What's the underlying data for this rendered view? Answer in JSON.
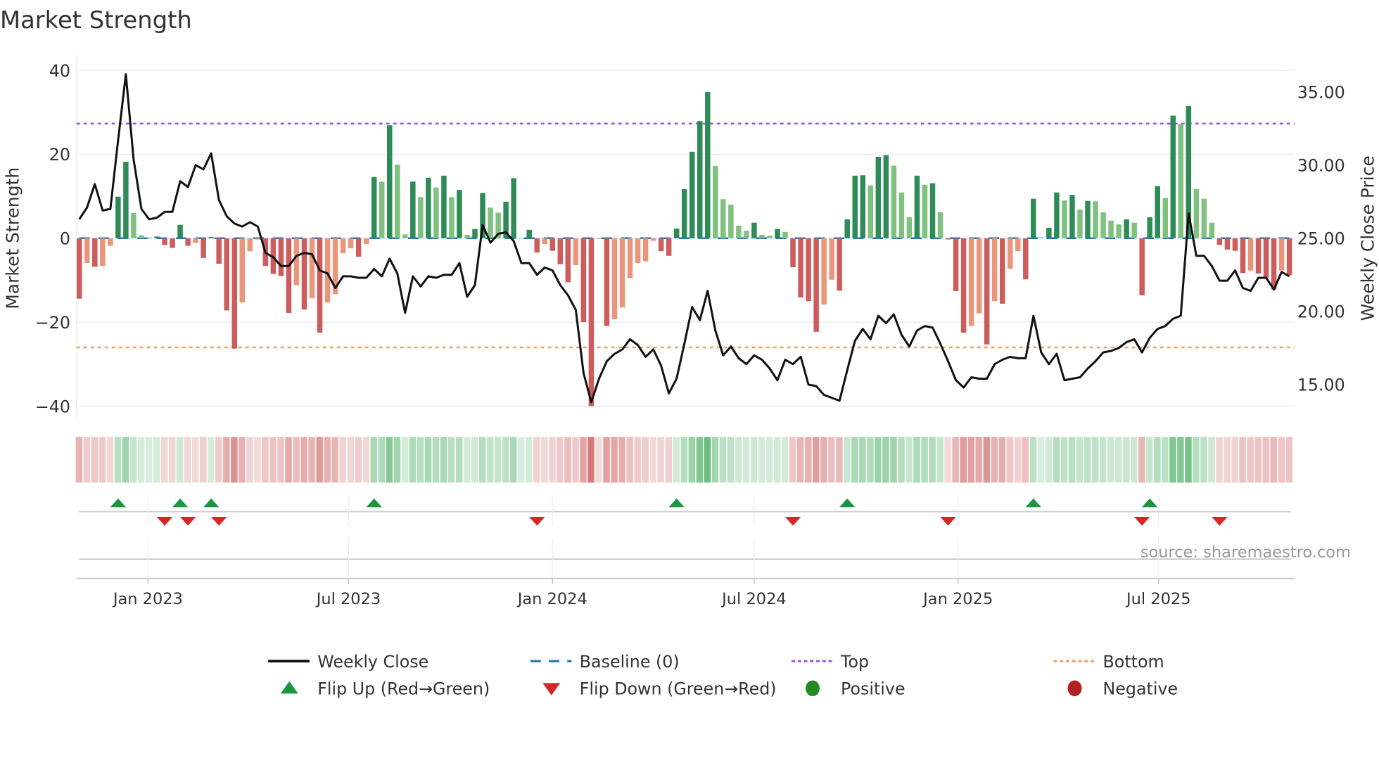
{
  "chart_data": {
    "type": "bar",
    "title": "Market Strength",
    "ylabel": "Market Strength",
    "y2label": "Weekly Close Price",
    "ylim": [
      -44,
      44
    ],
    "y2lim": [
      12.3,
      37.7
    ],
    "yticks": [
      40,
      20,
      0,
      -20,
      -40
    ],
    "yticklabels": [
      "40",
      "20",
      "0",
      "−20",
      "−40"
    ],
    "y2ticks": [
      35,
      30,
      25,
      20,
      15
    ],
    "y2ticklabels": [
      "35.00",
      "30.00",
      "25.00",
      "20.00",
      "15.00"
    ],
    "xticks": [
      "2023-01-01",
      "2023-07-01",
      "2024-01-01",
      "2024-07-01",
      "2025-01-01",
      "2025-07-01"
    ],
    "xticklabels": [
      "Jan 2023",
      "Jul 2023",
      "Jan 2024",
      "Jul 2024",
      "Jan 2025",
      "Jul 2025"
    ],
    "frequency": "weekly",
    "start_date": "2022-10-31",
    "strength": [
      -14.4,
      -5.9,
      -6.8,
      -6.6,
      -1.8,
      9.9,
      18.2,
      6.0,
      0.7,
      0.2,
      0.4,
      -1.6,
      -2.3,
      3.2,
      -1.8,
      -1.1,
      -4.7,
      0.3,
      -6.1,
      -17.2,
      -26.3,
      -15.3,
      -3.1,
      -0.3,
      -6.6,
      -8.5,
      -9.0,
      -17.8,
      -11.2,
      -17.0,
      -14.3,
      -22.5,
      -15.3,
      -13.3,
      -3.6,
      -2.4,
      -4.4,
      -1.4,
      14.6,
      13.5,
      26.9,
      17.5,
      0.9,
      13.5,
      9.8,
      14.4,
      12.1,
      14.9,
      9.8,
      11.5,
      0.8,
      2.2,
      10.8,
      7.3,
      6.1,
      8.7,
      14.3,
      0.1,
      2.0,
      -3.4,
      -1.4,
      -3.0,
      -6.2,
      -10.5,
      -6.4,
      -20.0,
      -40.0,
      -0.2,
      -20.9,
      -19.3,
      -16.5,
      -9.5,
      -5.9,
      -5.5,
      -0.6,
      -3.1,
      -4.2,
      2.3,
      11.7,
      20.6,
      27.9,
      34.8,
      17.2,
      9.3,
      8.0,
      3.0,
      1.8,
      3.7,
      0.8,
      0.6,
      2.2,
      1.5,
      -6.9,
      -14.1,
      -15.0,
      -22.3,
      -15.8,
      -9.9,
      -12.5,
      4.5,
      14.9,
      15.0,
      12.6,
      19.4,
      19.8,
      17.3,
      10.9,
      5.0,
      14.9,
      12.7,
      13.1,
      6.2,
      -0.3,
      -12.6,
      -22.5,
      -20.9,
      -17.9,
      -25.3,
      -15.0,
      -15.6,
      -7.3,
      -3.1,
      -9.8,
      9.4,
      0.2,
      2.5,
      10.9,
      9.0,
      10.3,
      6.8,
      8.9,
      8.8,
      6.2,
      4.2,
      3.3,
      4.5,
      3.7,
      -13.6,
      5.0,
      12.4,
      9.6,
      29.2,
      27.2,
      31.5,
      11.7,
      9.4,
      3.7,
      -1.6,
      -2.7,
      -3.0,
      -8.3,
      -7.7,
      -8.4,
      -9.4,
      -12.2,
      -7.7,
      -8.8
    ],
    "close": [
      26.3,
      27.1,
      28.7,
      26.9,
      27.0,
      31.7,
      36.2,
      30.4,
      27.0,
      26.3,
      26.4,
      26.8,
      26.8,
      28.9,
      28.5,
      30.0,
      29.7,
      30.8,
      27.6,
      26.5,
      26.0,
      25.8,
      26.1,
      25.8,
      24.0,
      23.7,
      23.1,
      23.1,
      23.8,
      24.0,
      23.9,
      22.8,
      22.6,
      21.6,
      22.4,
      22.4,
      22.3,
      22.3,
      22.9,
      22.4,
      23.6,
      22.6,
      19.9,
      22.4,
      21.7,
      22.4,
      22.3,
      22.5,
      22.5,
      23.3,
      21.0,
      21.8,
      25.9,
      24.7,
      25.3,
      25.4,
      24.8,
      23.3,
      23.3,
      22.5,
      23.0,
      22.8,
      21.8,
      21.1,
      20.1,
      15.8,
      13.8,
      15.4,
      16.6,
      17.1,
      17.4,
      18.1,
      17.7,
      16.9,
      17.4,
      16.3,
      14.4,
      15.4,
      17.8,
      20.3,
      19.4,
      21.4,
      18.7,
      17.0,
      17.6,
      16.8,
      16.4,
      17.0,
      16.7,
      16.1,
      15.3,
      16.7,
      16.4,
      16.9,
      15.0,
      14.9,
      14.3,
      14.1,
      13.9,
      16.0,
      18.0,
      18.8,
      18.1,
      19.7,
      19.2,
      19.8,
      18.4,
      17.6,
      18.7,
      19.0,
      18.9,
      17.8,
      16.6,
      15.3,
      14.8,
      15.5,
      15.4,
      15.4,
      16.4,
      16.7,
      16.9,
      16.8,
      16.8,
      19.7,
      17.2,
      16.4,
      17.1,
      15.3,
      15.4,
      15.5,
      16.1,
      16.6,
      17.2,
      17.3,
      17.5,
      17.9,
      18.1,
      17.2,
      18.2,
      18.8,
      19.0,
      19.5,
      19.7,
      26.7,
      23.8,
      23.8,
      23.1,
      22.1,
      22.1,
      22.8,
      21.6,
      21.4,
      22.3,
      22.3,
      21.5,
      22.7,
      22.4
    ],
    "top": 27.3,
    "bottom": -26.0,
    "baseline": 0,
    "grid": true,
    "legend_placement": "bottom",
    "legend": [
      "Weekly Close",
      "Baseline (0)",
      "Top",
      "Bottom",
      "Flip Up (Red→Green)",
      "Flip Down (Green→Red)",
      "Positive",
      "Negative"
    ],
    "annotation": "source: sharemaestro.com"
  },
  "colors": {
    "strong_pos": "#2e8b57",
    "weak_pos": "#80c080",
    "strong_neg": "#cd5c5c",
    "weak_neg": "#e9967a",
    "close": "#111111",
    "baseline": "#1f77b4",
    "top": "#9b59d6",
    "bottom": "#f0a060",
    "flip_up": "#1a9641",
    "flip_down": "#d62728",
    "positive": "#228b22",
    "negative": "#b22222"
  }
}
